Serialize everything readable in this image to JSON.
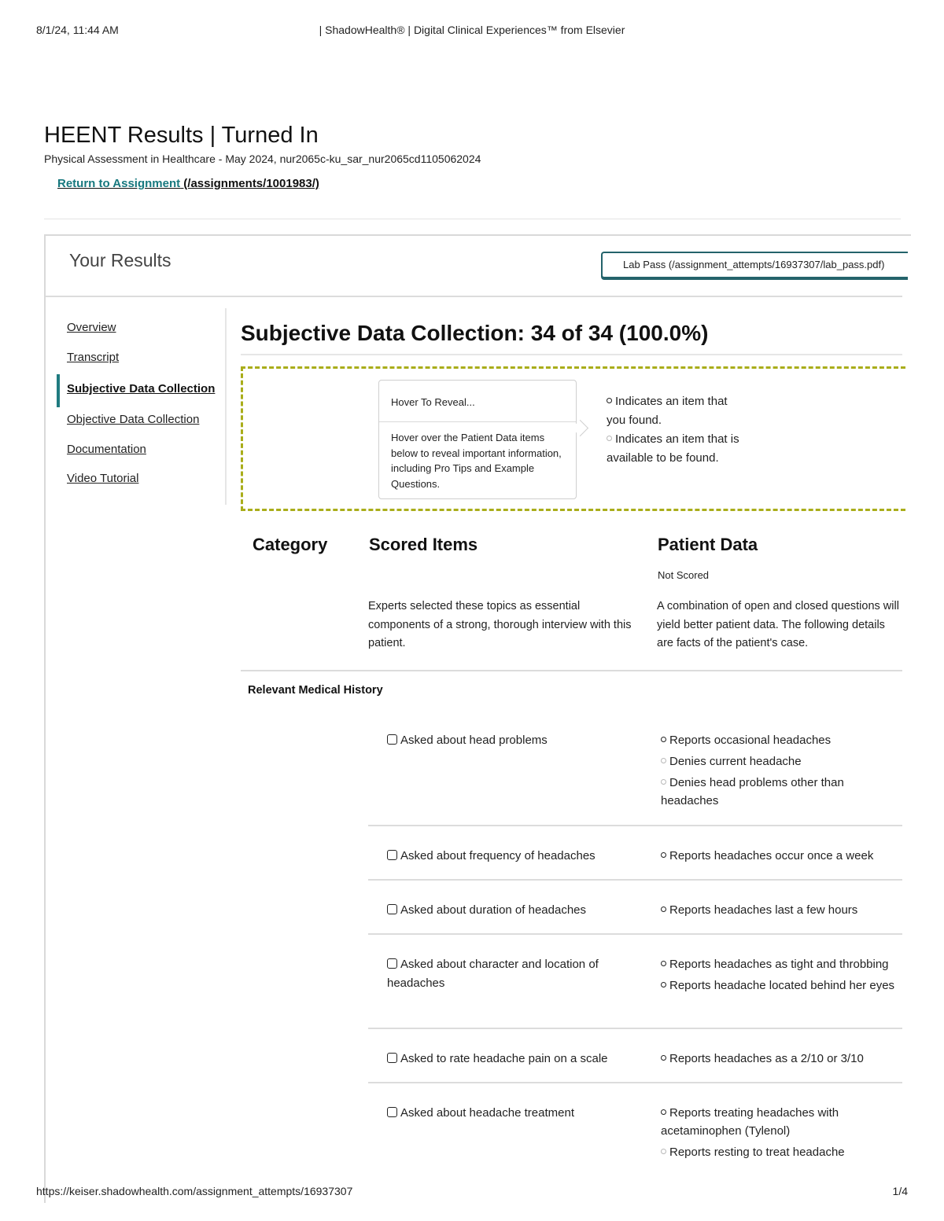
{
  "print_header": {
    "datetime": "8/1/24, 11:44 AM",
    "title": "| ShadowHealth® | Digital Clinical Experiences™ from Elsevier"
  },
  "print_footer": {
    "url": "https://keiser.shadowhealth.com/assignment_attempts/16937307",
    "page": "1/4"
  },
  "page": {
    "title": "HEENT Results | Turned In",
    "subtitle": "Physical Assessment in Healthcare - May 2024, nur2065c-ku_sar_nur2065cd1105062024",
    "return_link_text": "Return to Assignment",
    "return_link_url": " (/assignments/1001983/)"
  },
  "results": {
    "title": "Your Results",
    "lab_pass_label": "Lab Pass (/assignment_attempts/16937307/lab_pass.pdf)"
  },
  "nav": {
    "items": [
      {
        "label": "Overview"
      },
      {
        "label": "Transcript"
      },
      {
        "label": "Subjective Data Collection",
        "active": true
      },
      {
        "label": "Objective Data Collection"
      },
      {
        "label": "Documentation"
      },
      {
        "label": "Video Tutorial"
      }
    ]
  },
  "section": {
    "title": "Subjective Data Collection: 34 of 34 (100.0%)"
  },
  "legend": {
    "hover_title": "Hover To Reveal...",
    "hover_body": "Hover over the Patient Data items below to reveal important information, including Pro Tips and Example Questions.",
    "found_text": "Indicates an item that you found.",
    "available_text": "Indicates an item that is available to be found."
  },
  "columns": {
    "category": "Category",
    "scored": "Scored Items",
    "patient": "Patient Data",
    "not_scored": "Not Scored",
    "scored_desc": "Experts selected these topics as essential components of a strong, thorough interview with this patient.",
    "patient_desc": "A combination of open and closed questions will yield better patient data. The following details are facts of the patient's case."
  },
  "category": {
    "name": "Relevant Medical History"
  },
  "items": [
    {
      "scored": "Asked about head problems",
      "data": [
        {
          "text": "Reports occasional headaches",
          "found": true
        },
        {
          "text": "Denies current headache",
          "found": false
        },
        {
          "text": "Denies head problems other than headaches",
          "found": false
        }
      ]
    },
    {
      "scored": "Asked about frequency of headaches",
      "data": [
        {
          "text": "Reports headaches occur once a week",
          "found": true
        }
      ]
    },
    {
      "scored": "Asked about duration of headaches",
      "data": [
        {
          "text": "Reports headaches last a few hours",
          "found": true
        }
      ]
    },
    {
      "scored": "Asked about character and location of headaches",
      "data": [
        {
          "text": "Reports headaches as tight and throbbing",
          "found": true
        },
        {
          "text": "Reports headache located behind her eyes",
          "found": true
        }
      ]
    },
    {
      "scored": "Asked to rate headache pain on a scale",
      "data": [
        {
          "text": "Reports headaches as a 2/10 or 3/10",
          "found": true
        }
      ]
    },
    {
      "scored": "Asked about headache treatment",
      "data": [
        {
          "text": "Reports treating headaches with acetaminophen (Tylenol)",
          "found": true
        },
        {
          "text": "Reports resting to treat headache",
          "found": false
        }
      ]
    }
  ]
}
